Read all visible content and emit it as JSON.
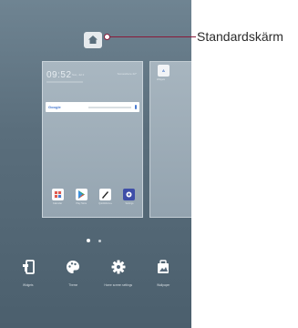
{
  "home_screen": {
    "clock_time": "09:52",
    "date_text": "Sun, Jul 2",
    "weather_text": "Somewhere 22°",
    "search_logo": "Google",
    "dock_apps": [
      {
        "name": "calendar",
        "label": "Calendar",
        "color": "#ffffff"
      },
      {
        "name": "play-store",
        "label": "Play Store",
        "color": "#ffffff"
      },
      {
        "name": "qmemo",
        "label": "QuickMemo+",
        "color": "#ffffff"
      },
      {
        "name": "settings",
        "label": "Settings",
        "color": "#3e4ea8"
      }
    ],
    "page2_icon_text": "A",
    "page2_label": "Widgets",
    "page_indicator": {
      "count": 2,
      "active": 1
    }
  },
  "bottom_options": [
    {
      "icon": "widgets-icon",
      "label": "Widgets"
    },
    {
      "icon": "palette-icon",
      "label": "Theme"
    },
    {
      "icon": "gear-icon",
      "label": "Home screen settings"
    },
    {
      "icon": "wallpaper-icon",
      "label": "Wallpaper"
    }
  ],
  "callout": {
    "label": "Standardskärm",
    "color": "#8a1a3a"
  }
}
